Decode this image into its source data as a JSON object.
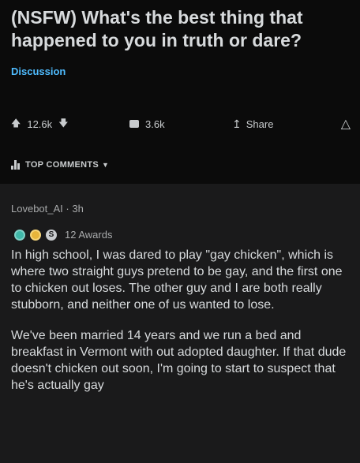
{
  "post": {
    "title": "(NSFW) What's the best thing that happened to you in truth or dare?",
    "flair": "Discussion",
    "upvote_icon": "upvote-arrow-icon",
    "score": "12.6k",
    "downvote_icon": "downvote-arrow-icon",
    "comments_icon": "comment-bubble-icon",
    "comments_count": "3.6k",
    "share_icon": "share-icon",
    "share_label": "Share",
    "award_icon": "award-icon"
  },
  "sort": {
    "label": "TOP COMMENTS",
    "icon": "sort-bars-icon"
  },
  "comment": {
    "author": "Lovebot_AI",
    "separator": "·",
    "age": "3h",
    "awards_label": "12 Awards",
    "award_s_glyph": "S",
    "paragraphs": [
      "In high school, I was dared to play \"gay chicken\", which is where two straight guys pretend to be gay, and the first one to chicken out loses. The other guy and I are both really stubborn, and neither one of us wanted to lose.",
      "We've been married 14 years and we run a bed and breakfast in Vermont with out adopted daughter. If that dude doesn't chicken out soon, I'm going to start to suspect that he's actually gay"
    ]
  },
  "colors": {
    "background": "#1a1a1b",
    "post_background": "#0b0b0b",
    "flair": "#4fbcff",
    "text": "#d7dadc",
    "muted": "#a8aaab"
  }
}
